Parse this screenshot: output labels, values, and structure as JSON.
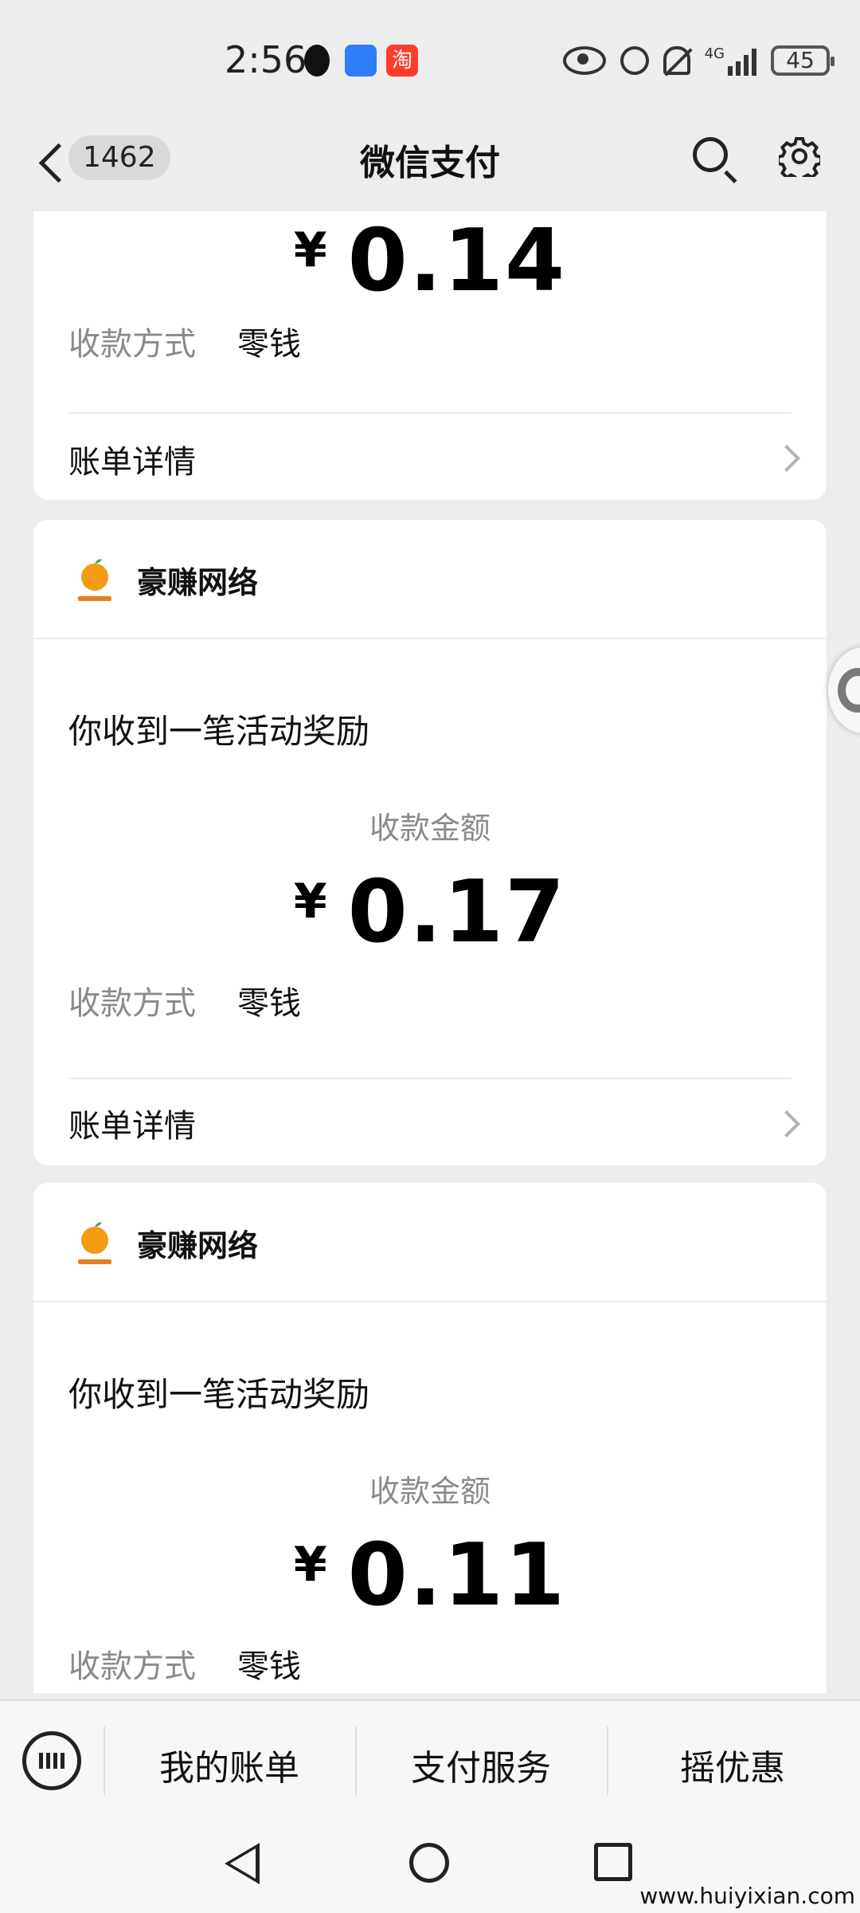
{
  "status_bar": {
    "time": "2:56",
    "network": "4G",
    "battery": "45"
  },
  "header": {
    "back_count": "1462",
    "title": "微信支付"
  },
  "top_card": {
    "amount_symbol": "¥",
    "amount": "0.14",
    "method_label": "收款方式",
    "method_value": "零钱",
    "detail_label": "账单详情"
  },
  "cards": [
    {
      "merchant": "豪赚网络",
      "headline": "你收到一笔活动奖励",
      "amount_label": "收款金额",
      "amount_symbol": "¥",
      "amount": "0.17",
      "method_label": "收款方式",
      "method_value": "零钱",
      "detail_label": "账单详情"
    },
    {
      "merchant": "豪赚网络",
      "headline": "你收到一笔活动奖励",
      "amount_label": "收款金额",
      "amount_symbol": "¥",
      "amount": "0.11",
      "method_label": "收款方式",
      "method_value": "零钱"
    }
  ],
  "bottom_menu": {
    "items": [
      "我的账单",
      "支付服务",
      "摇优惠"
    ]
  },
  "watermark": "www.huiyixian.com",
  "icons": [
    "qq-icon",
    "shield-icon",
    "taobao-icon",
    "eye-icon",
    "alarm-icon",
    "mute-bell-icon",
    "signal-icon",
    "battery-icon",
    "back-icon",
    "search-icon",
    "gear-icon",
    "keyboard-icon",
    "chevron-right-icon"
  ]
}
